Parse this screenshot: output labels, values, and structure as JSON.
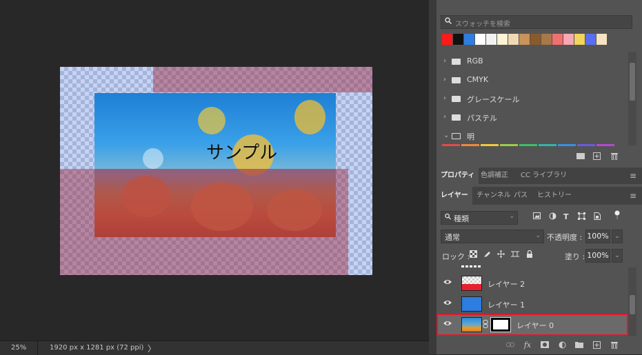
{
  "canvas": {
    "overlay_text": "サンプル"
  },
  "status_bar": {
    "zoom": "25%",
    "document_size": "1920 px x 1281 px (72 ppi)",
    "arrow": "〉"
  },
  "swatches": {
    "search_placeholder": "スウォッチを検索",
    "colors": [
      "#ff1a1a",
      "#111111",
      "#2e7de0",
      "#ffffff",
      "#f2f2f2",
      "#fff3d6",
      "#f0d8b4",
      "#c9935a",
      "#8b5a2b",
      "#a8784a",
      "#f07070",
      "#f6a8b4",
      "#f2d45c",
      "#5a6ef0",
      "#f7e3c4"
    ],
    "groups": [
      {
        "name": "RGB",
        "expanded": false
      },
      {
        "name": "CMYK",
        "expanded": false
      },
      {
        "name": "グレースケール",
        "expanded": false
      },
      {
        "name": "パステル",
        "expanded": false
      },
      {
        "name": "明",
        "expanded": true
      }
    ],
    "light_strip_colors": [
      "#e24b4b",
      "#f08a3a",
      "#f0c93a",
      "#9ad04a",
      "#3cbf6a",
      "#2fb6a8",
      "#3a8fe0",
      "#6a5ae0",
      "#b24ad0"
    ]
  },
  "properties_tabs": [
    {
      "label": "プロパティ",
      "active": true
    },
    {
      "label": "色調補正",
      "active": false
    },
    {
      "label": "CC ライブラリ",
      "active": false
    }
  ],
  "layers_tabs": [
    {
      "label": "レイヤー",
      "active": true
    },
    {
      "label": "チャンネル",
      "active": false
    },
    {
      "label": "パス",
      "active": false
    },
    {
      "label": "ヒストリー",
      "active": false
    }
  ],
  "layers_controls": {
    "filter_label": "種類",
    "blend_mode": "通常",
    "opacity_label": "不透明度 :",
    "opacity_value": "100%",
    "lock_label": "ロック :",
    "fill_label": "塗り :",
    "fill_value": "100%"
  },
  "layers": [
    {
      "name": "レイヤー 2",
      "thumb": "checker-red",
      "visible": true,
      "selected": false
    },
    {
      "name": "レイヤー 1",
      "thumb": "blue",
      "visible": true,
      "selected": false
    },
    {
      "name": "レイヤー 0",
      "thumb": "photo",
      "visible": true,
      "selected": true,
      "has_mask": true
    }
  ],
  "accent_colors": {
    "selection_highlight": "#e0182d",
    "panel_bg": "#535353",
    "workspace_bg": "#282828"
  },
  "icons": [
    "search-icon",
    "folder-icon",
    "new-group-icon",
    "new-swatch-icon",
    "trash-icon",
    "panel-menu-icon",
    "eye-icon",
    "link-icon",
    "fx-icon",
    "mask-icon",
    "adjustment-icon"
  ]
}
